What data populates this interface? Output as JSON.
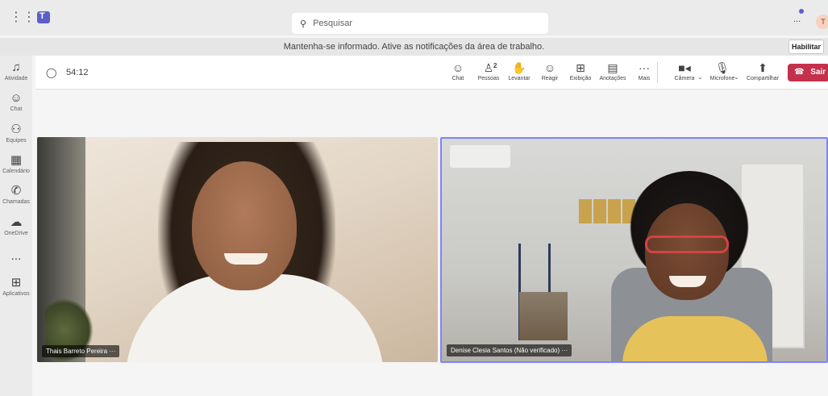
{
  "topbar": {
    "search_placeholder": "Pesquisar",
    "more": "...",
    "avatar_initial": "T"
  },
  "notification": {
    "text": "Mantenha-se informado. Ative as notificações da área de trabalho.",
    "enable_label": "Habilitar"
  },
  "rail": {
    "items": [
      {
        "label": "Atividade",
        "icon": "bell-icon"
      },
      {
        "label": "Chat",
        "icon": "chat-icon"
      },
      {
        "label": "Equipes",
        "icon": "teams-icon"
      },
      {
        "label": "Calendário",
        "icon": "calendar-icon"
      },
      {
        "label": "Chamadas",
        "icon": "phone-icon"
      },
      {
        "label": "OneDrive",
        "icon": "cloud-icon"
      },
      {
        "label": "...",
        "icon": "more-icon"
      },
      {
        "label": "Aplicativos",
        "icon": "apps-icon"
      }
    ]
  },
  "meeting": {
    "timer": "54:12",
    "tools": {
      "chat": "Chat",
      "people": "Pessoas",
      "people_count": "2",
      "raise": "Levantar",
      "react": "Reagir",
      "view": "Exibição",
      "notes": "Anotações",
      "more": "Mais",
      "camera": "Câmera",
      "mic": "Microfone",
      "share": "Compartilhar"
    },
    "leave_label": "Sair"
  },
  "participants": [
    {
      "name": "Thais Barreto Pereira",
      "more": "···"
    },
    {
      "name": "Denise Clesia Santos (Não verificado)",
      "more": "···"
    }
  ],
  "colors": {
    "accent": "#5b5fc7",
    "leave": "#c4314b",
    "active_speaker_border": "#7f85f5"
  }
}
